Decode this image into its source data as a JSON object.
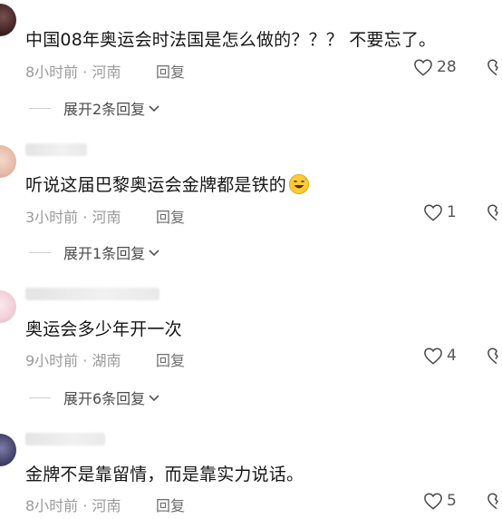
{
  "comments": [
    {
      "text": "中国08年奥运会时法国是怎么做的？？？ 不要忘了。",
      "time": "8小时前",
      "location": "河南",
      "reply_label": "回复",
      "likes": "28",
      "expand_label": "展开2条回复"
    },
    {
      "text": "听说这届巴黎奥运会金牌都是铁的",
      "emoji": "sweat-smile-emoji",
      "time": "3小时前",
      "location": "河南",
      "reply_label": "回复",
      "likes": "1",
      "expand_label": "展开1条回复"
    },
    {
      "text": "奥运会多少年开一次",
      "time": "9小时前",
      "location": "湖南",
      "reply_label": "回复",
      "likes": "4",
      "expand_label": "展开6条回复"
    },
    {
      "text": "金牌不是靠留情，而是靠实力说话。",
      "time": "8小时前",
      "location": "河南",
      "reply_label": "回复",
      "likes": "5"
    }
  ],
  "separator": " · ",
  "icons": {
    "like": "heart-outline-icon",
    "dislike": "broken-heart-icon",
    "expand": "chevron-down-icon"
  },
  "colors": {
    "text": "#161616",
    "meta": "#9a9a9a",
    "background": "#ffffff"
  }
}
